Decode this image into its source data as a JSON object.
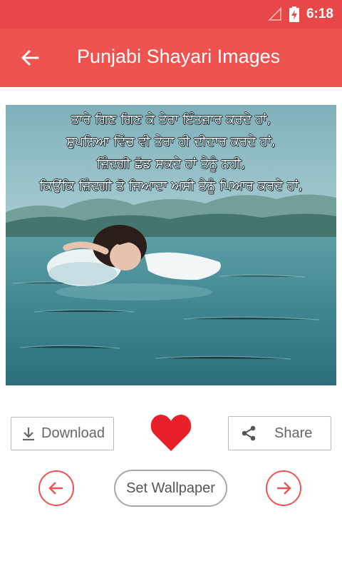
{
  "status_bar": {
    "time": "6:18"
  },
  "app_bar": {
    "title": "Punjabi Shayari Images"
  },
  "image": {
    "quote_lines": [
      "ਤਾਰੇ ਗਿਣ ਗਿਣ ਕੇ ਤੇਰਾ ਇੰਤਜ਼ਾਰ ਕਰਦੇ ਹਾਂ,",
      "ਸੁਪਨਿਆ ਵਿੱਚ ਵੀ ਤੇਰਾ ਹੀ ਦੀਦਾਰ ਕਰਦੇ ਹਾਂ,",
      "ਜ਼ਿੰਦਗੀ ਛੱਡ ਸਕਦੇ ਹਾਂ ਤੈਨੂੰ ਨਹੀ,",
      "ਕਿਉਂਕਿ ਜ਼ਿੰਦਗੀ ਤੋ ਜਿਆਦਾ ਅਸੀ ਤੈਨੂੰ ਪਿਆਰ ਕਰਦੇ ਹਾਂ,"
    ]
  },
  "actions": {
    "download_label": "Download",
    "share_label": "Share",
    "set_wallpaper_label": "Set Wallpaper"
  },
  "colors": {
    "primary": "#ef5350",
    "status_bar": "#e84747",
    "heart": "#e8202a"
  }
}
